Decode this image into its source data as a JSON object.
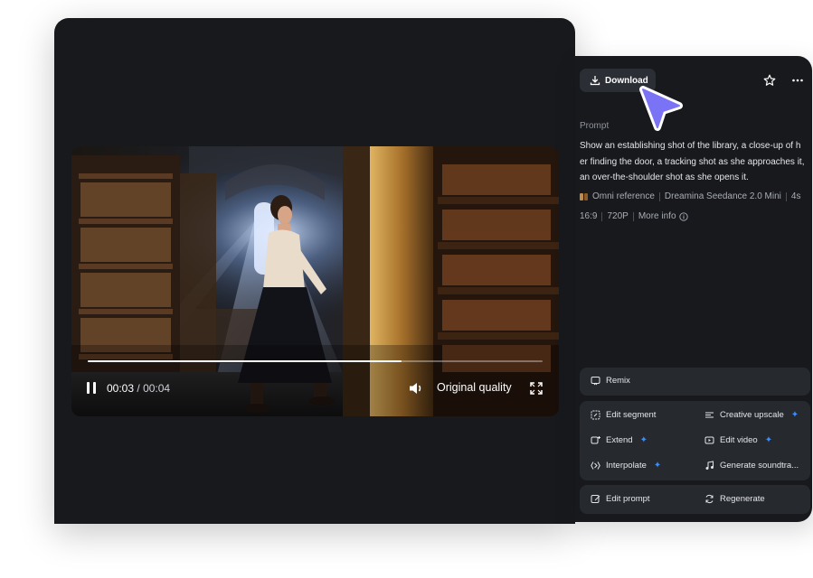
{
  "player": {
    "current_time": "00:03",
    "separator": "/",
    "duration": "00:04",
    "quality": "Original quality",
    "progress": 0.69
  },
  "panel": {
    "download_label": "Download",
    "prompt_label": "Prompt",
    "prompt_lines": [
      "Show an establishing shot of the library, a close-up of h",
      "er finding the door, a tracking shot as she approaches it,",
      "an over-the-shoulder shot as she opens it."
    ],
    "reference": "Omni reference",
    "model": "Dreamina Seedance 2.0 Mini",
    "duration": "4s",
    "ratio": "16:9",
    "resolution": "720P",
    "more_info": "More info"
  },
  "actions": {
    "remix": "Remix",
    "edit_segment": "Edit segment",
    "creative_upscale": "Creative upscale",
    "extend": "Extend",
    "edit_video": "Edit video",
    "interpolate": "Interpolate",
    "generate_soundtrack": "Generate soundtra...",
    "edit_prompt": "Edit prompt",
    "regenerate": "Regenerate"
  },
  "colors": {
    "panel_bg": "#17191d",
    "button_bg": "#26292e",
    "accent_spark": "#3b8cff",
    "cursor": "#7b73f5"
  }
}
